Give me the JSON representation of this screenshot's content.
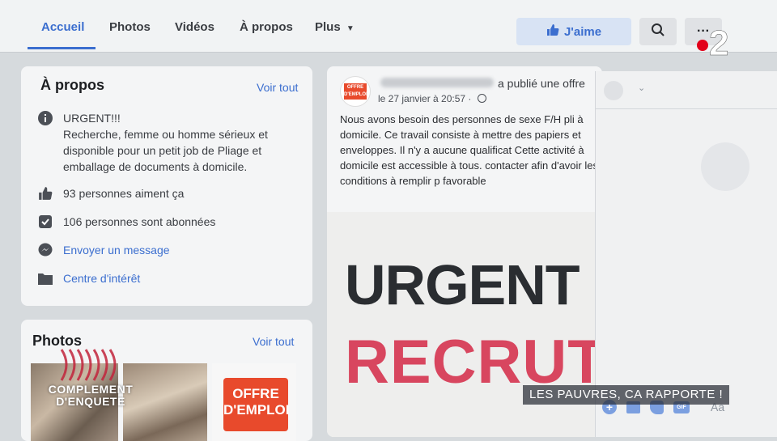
{
  "tabs": [
    {
      "label": "Accueil",
      "active": true
    },
    {
      "label": "Photos"
    },
    {
      "label": "Vidéos"
    },
    {
      "label": "À propos"
    },
    {
      "label": "Plus"
    }
  ],
  "like_button": "J'aime",
  "about": {
    "title": "À propos",
    "see_all": "Voir tout",
    "description": "URGENT!!!\nRecherche, femme ou homme sérieux et disponible pour un petit job de Pliage et emballage de documents à domicile.",
    "likes": "93 personnes aiment ça",
    "followers": "106 personnes sont abonnées",
    "message": "Envoyer un message",
    "category": "Centre d'intérêt"
  },
  "photos": {
    "title": "Photos",
    "see_all": "Voir tout",
    "thumb_logo_line1": "OFFRE",
    "thumb_logo_line2": "D'EMPLOI"
  },
  "post": {
    "action": "a publié une offre",
    "date": "le 27 janvier à 20:57 ·",
    "text": "Nous avons besoin des personnes de sexe F/H pli à domicile. Ce travail consiste à mettre des papiers et enveloppes. Il n'y a aucune qualificat Cette activité à domicile est accessible à tous. contacter afin d'avoir les conditions à remplir p favorable",
    "avatar_line1": "OFFRE",
    "avatar_line2": "D'EMPLOI",
    "image_line1": "URGENT ! /",
    "image_line2": "RECRUTE"
  },
  "chat": {
    "input_placeholder": "Aa"
  },
  "overlay": {
    "banner": "LES PAUVRES, CA RAPPORTE !",
    "show_line1": "COMPLEMENT",
    "show_line2": "D'ENQUETE",
    "channel": "2"
  },
  "colors": {
    "accent": "#3b6ecf",
    "offre_red": "#d8465f",
    "channel_red": "#e2001a"
  }
}
